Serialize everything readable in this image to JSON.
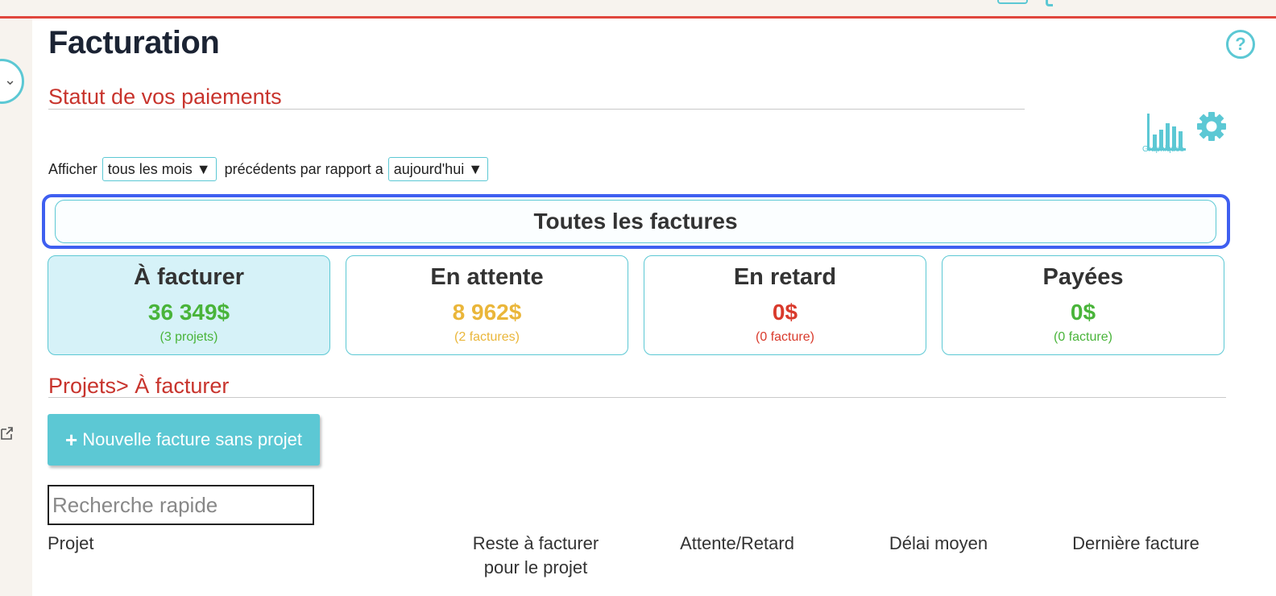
{
  "page": {
    "title": "Facturation"
  },
  "payments": {
    "section_title": "Statut de vos paiements",
    "graph_caption": "Graphiques",
    "filter": {
      "label_show": "Afficher",
      "period_value": "tous les mois",
      "label_relative": "précédents par rapport a",
      "reference_value": "aujourd'hui",
      "arrow": "▼"
    },
    "all_invoices_label": "Toutes les factures",
    "cards": [
      {
        "title": "À facturer",
        "amount": "36 349$",
        "sub": "(3 projets)",
        "color": "#49b43a"
      },
      {
        "title": "En attente",
        "amount": "8 962$",
        "sub": "(2 factures)",
        "color": "#eab63a"
      },
      {
        "title": "En retard",
        "amount": "0$",
        "sub": "(0 facture)",
        "color": "#d93a2c"
      },
      {
        "title": "Payées",
        "amount": "0$",
        "sub": "(0 facture)",
        "color": "#49b43a"
      }
    ]
  },
  "projects": {
    "section_title": "Projets> À facturer",
    "new_button_plus": "+",
    "new_button_label": "Nouvelle facture sans projet",
    "search_placeholder": "Recherche rapide",
    "columns": {
      "project": "Projet",
      "remaining_line1": "Reste à facturer",
      "remaining_line2": "pour le projet",
      "pending": "Attente/Retard",
      "delay": "Délai moyen",
      "last_invoice": "Dernière facture"
    }
  },
  "icons": {
    "help": "?",
    "sidebar_toggle": "⌄"
  },
  "colors": {
    "accent": "#5cc8d4",
    "title_red": "#c8342d",
    "focus_blue": "#3f5ff0"
  }
}
